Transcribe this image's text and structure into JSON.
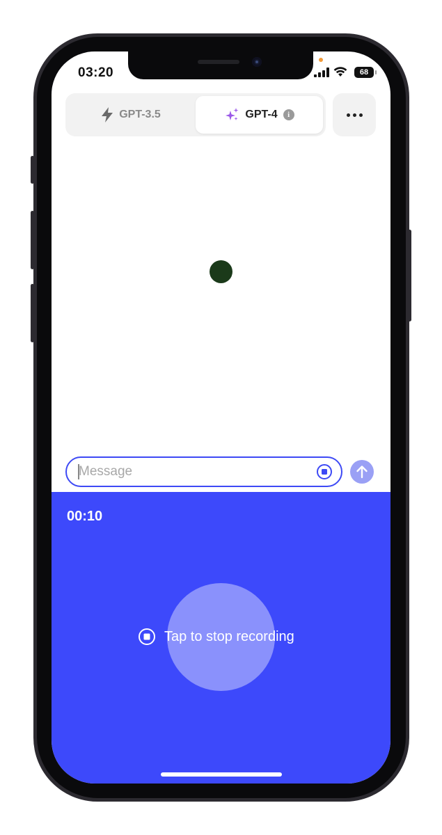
{
  "status_bar": {
    "time": "03:20",
    "battery": "68"
  },
  "model_switcher": {
    "options": [
      {
        "label": "GPT-3.5",
        "icon": "bolt-icon",
        "selected": false
      },
      {
        "label": "GPT-4",
        "icon": "sparkles-icon",
        "selected": true,
        "info_icon": "info-icon"
      }
    ],
    "more_icon": "ellipsis-icon"
  },
  "composer": {
    "placeholder": "Message",
    "value": "",
    "stop_icon": "stop-circle-icon",
    "send_icon": "arrow-up-icon"
  },
  "recording": {
    "timer": "00:10",
    "stop_label": "Tap to stop recording",
    "stop_icon": "stop-circle-icon"
  },
  "colors": {
    "accent": "#3d49fb",
    "send_button": "#9aa0f5",
    "thinking_dot": "#1b3a1a",
    "sparkle": "#9b59e8"
  }
}
